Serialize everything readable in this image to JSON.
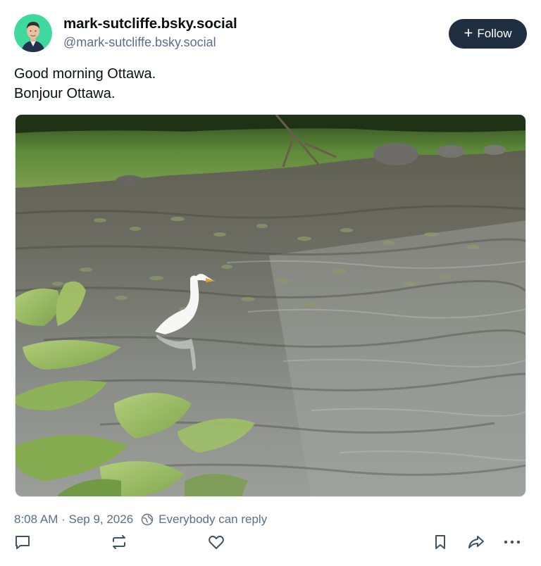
{
  "author": {
    "display_name": "mark-sutcliffe.bsky.social",
    "handle": "@mark-sutcliffe.bsky.social"
  },
  "follow_button": {
    "label": "Follow",
    "icon": "plus-icon"
  },
  "post": {
    "lines": [
      "Good morning Ottawa.",
      "Bonjour Ottawa."
    ],
    "image": {
      "subject": "great-egret-in-river",
      "icon": "photo"
    }
  },
  "meta": {
    "timestamp": "8:08 AM · Sep 9, 2026",
    "reply_setting": "Everybody can reply",
    "reply_icon": "globe-icon"
  },
  "actions": {
    "icons": [
      "reply-icon",
      "repost-icon",
      "like-icon",
      "bookmark-icon",
      "share-icon",
      "more-icon"
    ]
  },
  "colors": {
    "follow_bg": "#1f2e40",
    "muted_text": "#5b6f86",
    "avatar_bg": "#3fd9a0",
    "icon_stroke": "#3e5366"
  }
}
